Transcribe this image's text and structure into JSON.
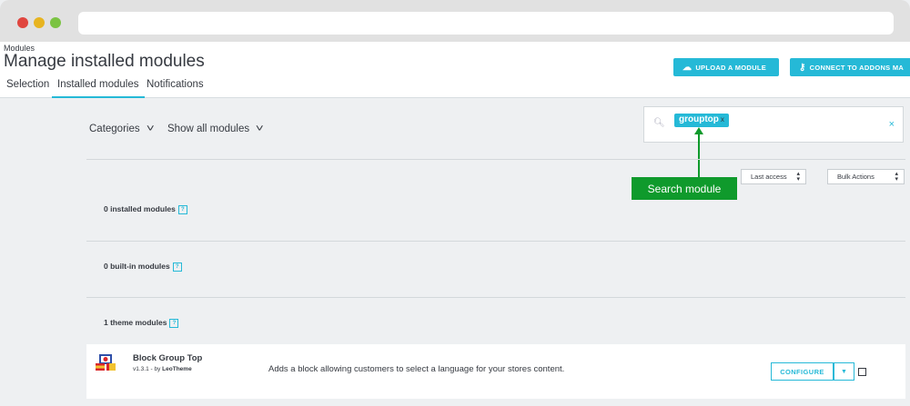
{
  "breadcrumb": "Modules",
  "page_title": "Manage installed modules",
  "tabs": [
    {
      "label": "Selection"
    },
    {
      "label": "Installed modules"
    },
    {
      "label": "Notifications"
    }
  ],
  "header_buttons": {
    "upload": {
      "label": "UPLOAD A MODULE",
      "icon": "cloud-upload-icon"
    },
    "connect": {
      "label": "CONNECT TO ADDONS MA",
      "icon": "key-icon"
    }
  },
  "filters": {
    "categories": "Categories",
    "show_all": "Show all modules"
  },
  "search": {
    "tag": "grouptop",
    "tag_remove": "x",
    "clear": "×"
  },
  "annotation": "Search module",
  "sort": {
    "selected": "Last access"
  },
  "bulk": {
    "selected": "Bulk Actions"
  },
  "sections": [
    {
      "title": "0 installed modules"
    },
    {
      "title": "0 built-in modules"
    },
    {
      "title": "1 theme modules"
    }
  ],
  "module": {
    "name": "Block Group Top",
    "version": "v1.3.1 - by",
    "author": "LeoTheme",
    "description": "Adds a block allowing customers to select a language for your stores content.",
    "configure_label": "CONFIGURE"
  },
  "colors": {
    "accent": "#25b9d7",
    "annotation": "#0f9a2c"
  }
}
